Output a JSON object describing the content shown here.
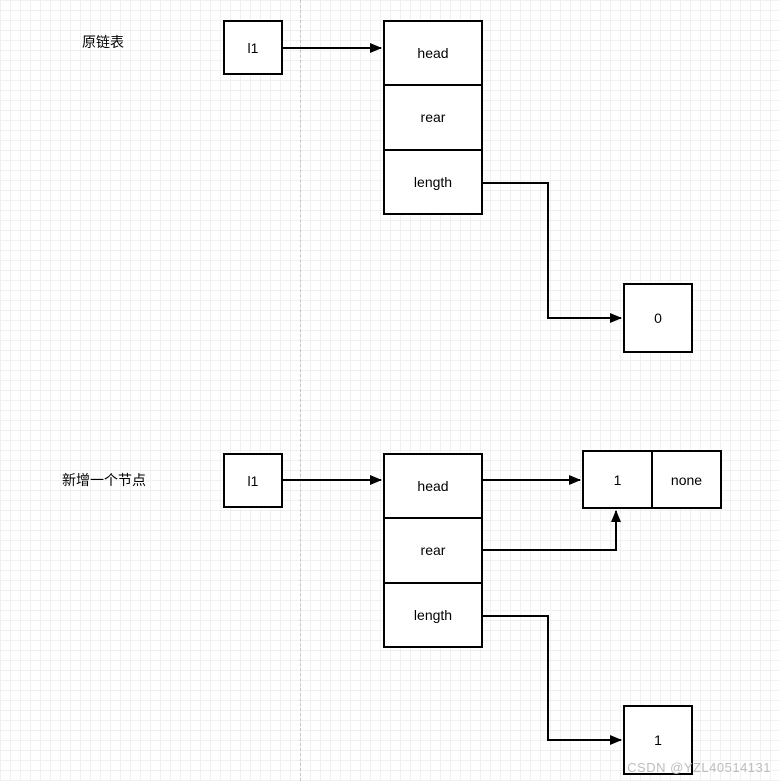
{
  "labels": {
    "section1": "原链表",
    "section2": "新增一个节点"
  },
  "section1": {
    "l1": "l1",
    "struct": {
      "head": "head",
      "rear": "rear",
      "length": "length"
    },
    "length_value": "0"
  },
  "section2": {
    "l1": "l1",
    "struct": {
      "head": "head",
      "rear": "rear",
      "length": "length"
    },
    "node": {
      "value": "1",
      "next": "none"
    },
    "length_value": "1"
  },
  "watermark": "CSDN @YZL40514131"
}
